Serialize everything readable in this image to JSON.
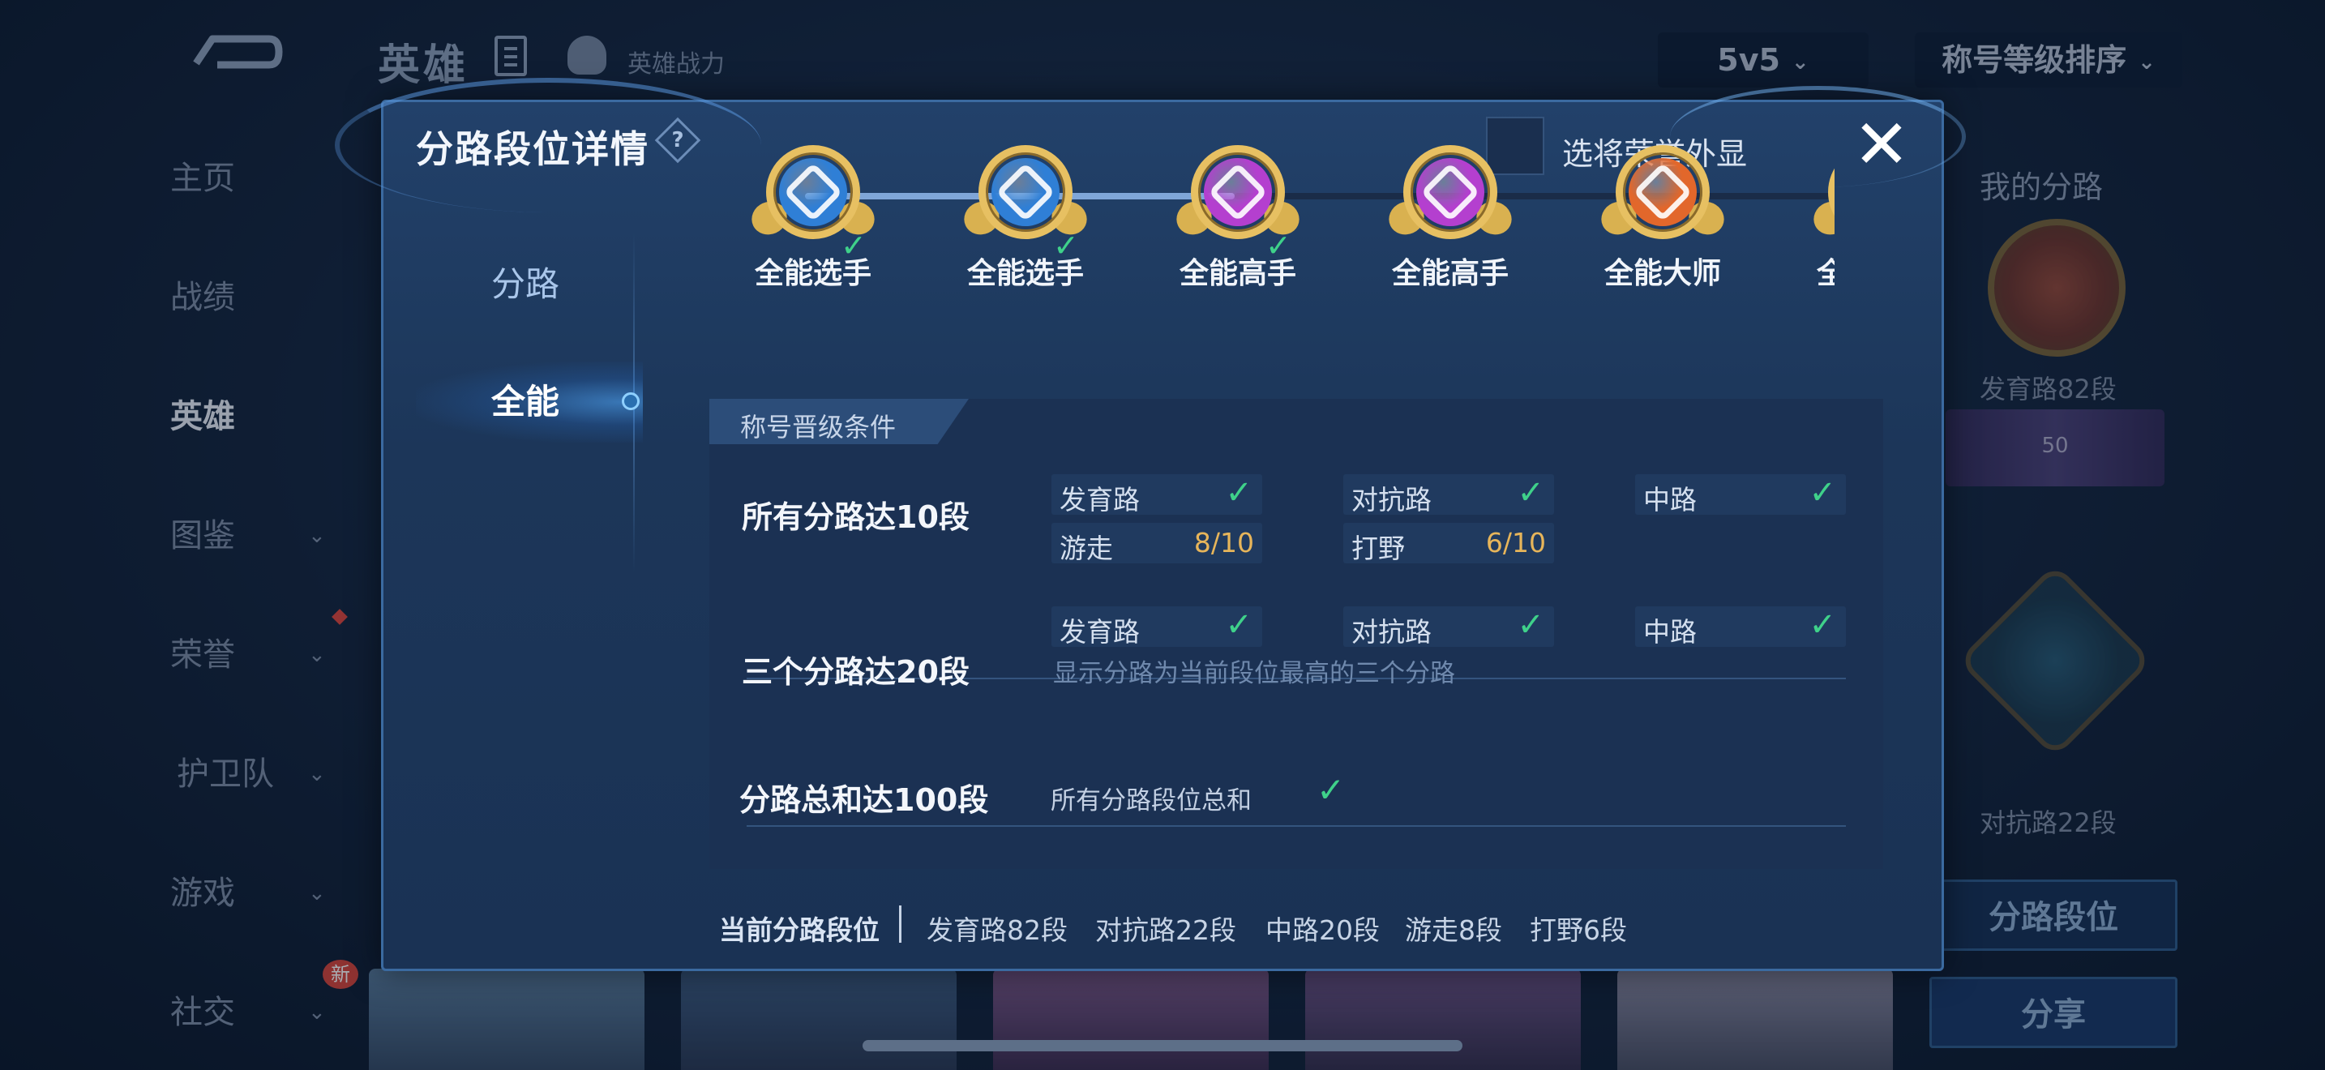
{
  "header": {
    "title": "英雄",
    "power_label": "英雄战力",
    "mode_dropdown": "5v5",
    "sort_dropdown": "称号等级排序"
  },
  "sidebar": {
    "items": [
      {
        "label": "主页",
        "has_chevron": false
      },
      {
        "label": "战绩",
        "has_chevron": false
      },
      {
        "label": "英雄",
        "has_chevron": false,
        "active": true
      },
      {
        "label": "图鉴",
        "has_chevron": true
      },
      {
        "label": "荣誉",
        "has_chevron": true
      },
      {
        "label": "护卫队",
        "has_chevron": true
      },
      {
        "label": "游戏",
        "has_chevron": true
      },
      {
        "label": "社交",
        "has_chevron": true
      }
    ],
    "new_badge": "新"
  },
  "right_panel": {
    "title": "我的分路",
    "lane1": "发育路82段",
    "rank_number": "50",
    "lane2": "对抗路22段",
    "lane_button": "分路段位",
    "share_button": "分享"
  },
  "modal": {
    "title": "分路段位详情",
    "help_glyph": "?",
    "honor_display_label": "选将荣誉外显",
    "close_glyph": "✕",
    "tabs": [
      "分路",
      "全能"
    ],
    "active_tab": "全能",
    "titles": [
      {
        "name": "全能选手",
        "tier": "blue",
        "achieved": true
      },
      {
        "name": "全能选手",
        "tier": "blue",
        "achieved": true
      },
      {
        "name": "全能高手",
        "tier": "purple",
        "achieved": true
      },
      {
        "name": "全能高手",
        "tier": "purple",
        "achieved": false
      },
      {
        "name": "全能大师",
        "tier": "orange",
        "achieved": false
      },
      {
        "name": "全能大师",
        "tier": "orange",
        "achieved": false
      }
    ],
    "conditions_header": "称号晋级条件",
    "conditions": [
      {
        "label": "所有分路达10段",
        "chips": [
          {
            "label": "发育路",
            "done": true
          },
          {
            "label": "对抗路",
            "done": true
          },
          {
            "label": "中路",
            "done": true
          },
          {
            "label": "游走",
            "progress": "8/10"
          },
          {
            "label": "打野",
            "progress": "6/10"
          }
        ]
      },
      {
        "label": "三个分路达20段",
        "chips": [
          {
            "label": "发育路",
            "done": true
          },
          {
            "label": "对抗路",
            "done": true
          },
          {
            "label": "中路",
            "done": true
          }
        ],
        "note": "显示分路为当前段位最高的三个分路"
      },
      {
        "label": "分路总和达100段",
        "note": "所有分路段位总和",
        "done": true
      }
    ],
    "footer": {
      "label": "当前分路段位",
      "items": [
        "发育路82段",
        "对抗路22段",
        "中路20段",
        "游走8段",
        "打野6段"
      ]
    }
  },
  "colors": {
    "check_green": "#3fd18a",
    "progress_orange": "#e7b55a",
    "tier_blue": "#2f7fd6",
    "tier_purple": "#b43fcf",
    "tier_orange": "#e2672b"
  }
}
